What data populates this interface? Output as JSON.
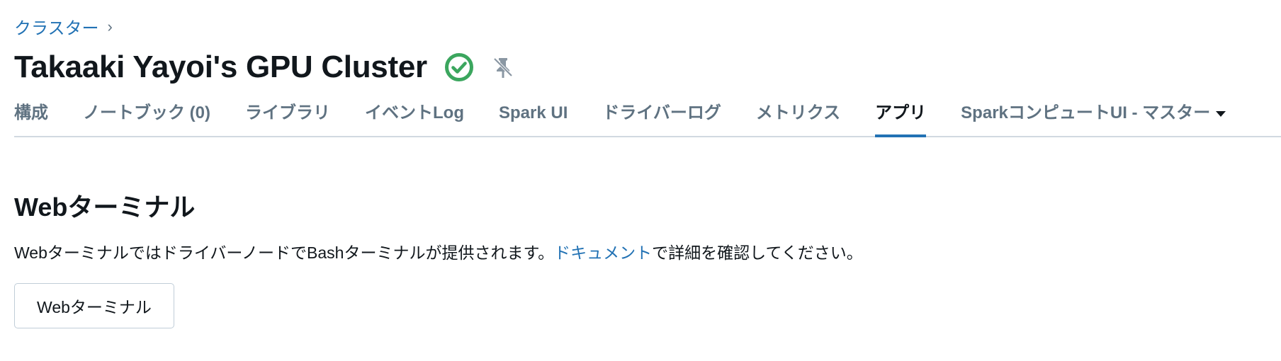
{
  "breadcrumb": {
    "parent_label": "クラスター",
    "separator": "›"
  },
  "cluster": {
    "title": "Takaaki Yayoi's GPU Cluster",
    "status": "running",
    "status_icon": "check-circle-icon",
    "status_color": "#3ba65e",
    "pin_icon": "pin-off-icon"
  },
  "tabs": [
    {
      "label": "構成",
      "active": false
    },
    {
      "label": "ノートブック (0)",
      "active": false
    },
    {
      "label": "ライブラリ",
      "active": false
    },
    {
      "label": "イベントLog",
      "active": false
    },
    {
      "label": "Spark UI",
      "active": false
    },
    {
      "label": "ドライバーログ",
      "active": false
    },
    {
      "label": "メトリクス",
      "active": false
    },
    {
      "label": "アプリ",
      "active": true
    },
    {
      "label": "SparkコンピュートUI - マスター",
      "active": false,
      "dropdown": true
    }
  ],
  "web_terminal": {
    "heading": "Webターミナル",
    "desc_before": "WebターミナルではドライバーノードでBashターミナルが提供されます。",
    "desc_link": "ドキュメント",
    "desc_after": "で詳細を確認してください。",
    "button_label": "Webターミナル"
  },
  "colors": {
    "accent": "#2272b4",
    "tab_inactive": "#5f7281",
    "text": "#11171c",
    "border": "#d1d9e1"
  }
}
